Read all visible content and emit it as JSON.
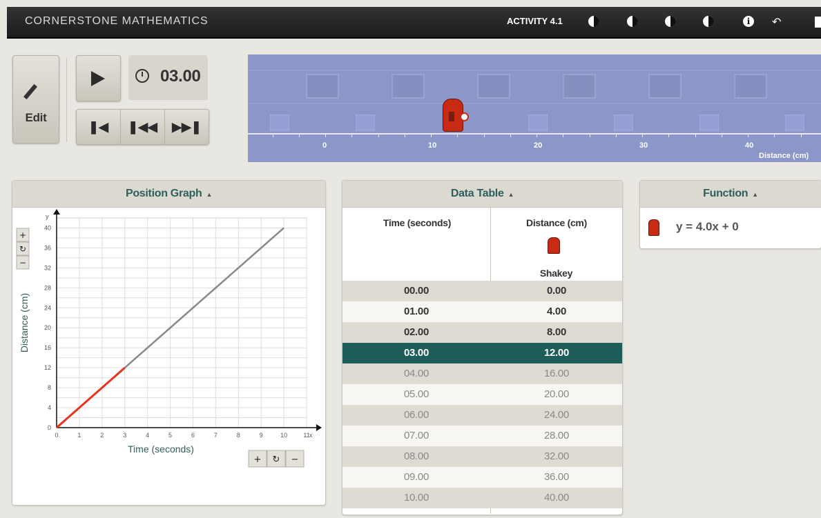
{
  "header": {
    "app_title": "CORNERSTONE MATHEMATICS",
    "activity_label": "ACTIVITY 4.1",
    "icons": [
      "contrast-icon",
      "contrast-icon",
      "contrast-icon",
      "contrast-icon",
      "info-icon",
      "back-icon",
      "exit-icon"
    ]
  },
  "controls": {
    "edit_label": "Edit",
    "timer_value": "03.00",
    "icons": [
      "pencil-icon",
      "play-icon",
      "stopwatch-icon",
      "skip-start-icon",
      "step-back-icon",
      "step-forward-icon"
    ]
  },
  "stage": {
    "axis_ticks": [
      "0",
      "10",
      "20",
      "30",
      "40"
    ],
    "axis_label": "Distance (cm)",
    "robot_position_cm": 12
  },
  "graph_panel": {
    "title": "Position Graph",
    "xlabel": "Time (seconds)",
    "ylabel": "Distance (cm)"
  },
  "chart_data": {
    "type": "line",
    "xlabel": "Time (seconds)",
    "ylabel": "Distance (cm)",
    "x_axis_letter": "x",
    "y_axis_letter": "y",
    "xlim": [
      0,
      11
    ],
    "ylim": [
      0,
      42
    ],
    "x_ticks": [
      "0",
      "1",
      "2",
      "3",
      "4",
      "5",
      "6",
      "7",
      "8",
      "9",
      "10",
      "11"
    ],
    "y_ticks": [
      "0",
      "4",
      "8",
      "12",
      "16",
      "20",
      "24",
      "28",
      "32",
      "36",
      "40"
    ],
    "series": [
      {
        "x": [
          0,
          10
        ],
        "y": [
          0,
          40
        ],
        "color": "#888888"
      },
      {
        "x": [
          0,
          3
        ],
        "y": [
          0,
          12
        ],
        "color": "#e8321e"
      }
    ],
    "grid": true
  },
  "table_panel": {
    "title": "Data Table",
    "col_time": "Time (seconds)",
    "col_distance": "Distance (cm)",
    "robot_name": "Shakey",
    "current_index": 3,
    "rows": [
      {
        "t": "00.00",
        "d": "0.00"
      },
      {
        "t": "01.00",
        "d": "4.00"
      },
      {
        "t": "02.00",
        "d": "8.00"
      },
      {
        "t": "03.00",
        "d": "12.00"
      },
      {
        "t": "04.00",
        "d": "16.00"
      },
      {
        "t": "05.00",
        "d": "20.00"
      },
      {
        "t": "06.00",
        "d": "24.00"
      },
      {
        "t": "07.00",
        "d": "28.00"
      },
      {
        "t": "08.00",
        "d": "32.00"
      },
      {
        "t": "09.00",
        "d": "36.00"
      },
      {
        "t": "10.00",
        "d": "40.00"
      }
    ]
  },
  "function_panel": {
    "title": "Function",
    "equation": "y = 4.0x + 0"
  },
  "colors": {
    "accent": "#1e5c58",
    "robot": "#c82b14",
    "active_line": "#e8321e",
    "inactive_line": "#888888",
    "stage": "#8b96c9"
  }
}
